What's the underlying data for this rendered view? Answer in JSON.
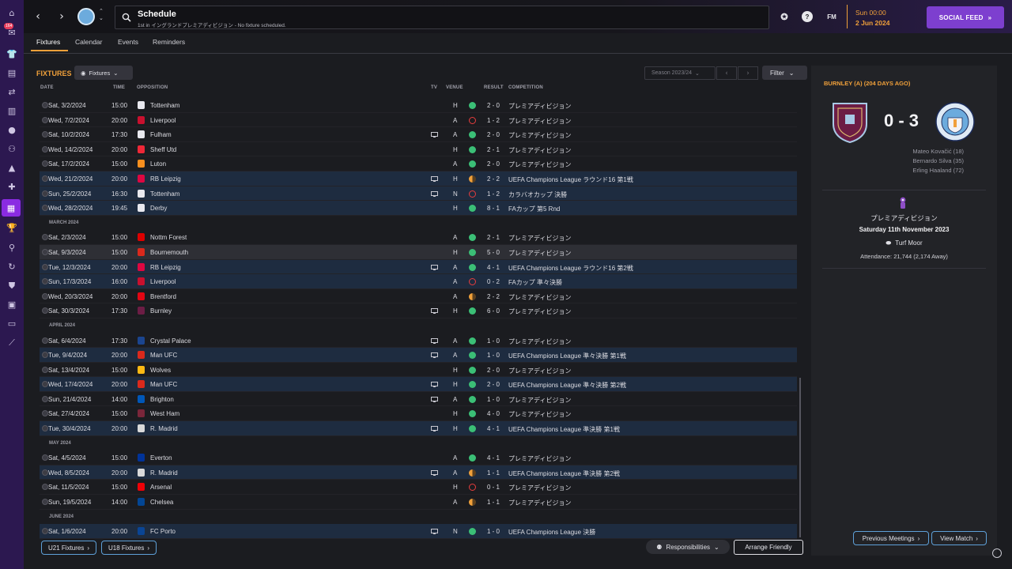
{
  "sidebar": {
    "badge": "164"
  },
  "topbar": {
    "title": "Schedule",
    "subtitle": "1st in イングランドプレミアディビジョン - No fixture scheduled.",
    "help_label": "?",
    "fm_label": "FM",
    "time": "Sun 00:00",
    "date": "2 Jun 2024",
    "social_feed": "SOCIAL FEED"
  },
  "tabs": [
    "Fixtures",
    "Calendar",
    "Events",
    "Reminders"
  ],
  "toolbar": {
    "title": "FIXTURES",
    "view_dropdown": "Fixtures",
    "season": "Season 2023/24",
    "filter": "Filter"
  },
  "columns": {
    "date": "DATE",
    "time": "TIME",
    "opposition": "OPPOSITION",
    "tv": "TV",
    "venue": "VENUE",
    "result": "RESULT",
    "competition": "COMPETITION"
  },
  "fixtures": [
    {
      "date": "Sat, 3/2/2024",
      "time": "15:00",
      "opp": "Tottenham",
      "tv": false,
      "venue": "H",
      "res": "W",
      "score": "2 - 0",
      "comp": "プレミアディビジョン",
      "hl": false
    },
    {
      "date": "Wed, 7/2/2024",
      "time": "20:00",
      "opp": "Liverpool",
      "tv": false,
      "venue": "A",
      "res": "L",
      "score": "1 - 2",
      "comp": "プレミアディビジョン",
      "hl": false
    },
    {
      "date": "Sat, 10/2/2024",
      "time": "17:30",
      "opp": "Fulham",
      "tv": true,
      "venue": "A",
      "res": "W",
      "score": "2 - 0",
      "comp": "プレミアディビジョン",
      "hl": false
    },
    {
      "date": "Wed, 14/2/2024",
      "time": "20:00",
      "opp": "Sheff Utd",
      "tv": false,
      "venue": "H",
      "res": "W",
      "score": "2 - 1",
      "comp": "プレミアディビジョン",
      "hl": false
    },
    {
      "date": "Sat, 17/2/2024",
      "time": "15:00",
      "opp": "Luton",
      "tv": false,
      "venue": "A",
      "res": "W",
      "score": "2 - 0",
      "comp": "プレミアディビジョン",
      "hl": false
    },
    {
      "date": "Wed, 21/2/2024",
      "time": "20:00",
      "opp": "RB Leipzig",
      "tv": true,
      "venue": "H",
      "res": "D",
      "score": "2 - 2",
      "comp": "UEFA Champions League ラウンド16 第1戦",
      "hl": true
    },
    {
      "date": "Sun, 25/2/2024",
      "time": "16:30",
      "opp": "Tottenham",
      "tv": true,
      "venue": "N",
      "res": "L",
      "score": "1 - 2",
      "comp": "カラバオカップ 決勝",
      "hl": true
    },
    {
      "date": "Wed, 28/2/2024",
      "time": "19:45",
      "opp": "Derby",
      "tv": false,
      "venue": "H",
      "res": "W",
      "score": "8 - 1",
      "comp": "FAカップ 第5 Rnd",
      "hl": true
    },
    {
      "month": "MARCH 2024"
    },
    {
      "date": "Sat, 2/3/2024",
      "time": "15:00",
      "opp": "Nottm Forest",
      "tv": false,
      "venue": "A",
      "res": "W",
      "score": "2 - 1",
      "comp": "プレミアディビジョン",
      "hl": false
    },
    {
      "date": "Sat, 9/3/2024",
      "time": "15:00",
      "opp": "Bournemouth",
      "tv": false,
      "venue": "H",
      "res": "W",
      "score": "5 - 0",
      "comp": "プレミアディビジョン",
      "hl": false,
      "sel": true
    },
    {
      "date": "Tue, 12/3/2024",
      "time": "20:00",
      "opp": "RB Leipzig",
      "tv": true,
      "venue": "A",
      "res": "W",
      "score": "4 - 1",
      "comp": "UEFA Champions League ラウンド16 第2戦",
      "hl": true
    },
    {
      "date": "Sun, 17/3/2024",
      "time": "16:00",
      "opp": "Liverpool",
      "tv": false,
      "venue": "A",
      "res": "L",
      "score": "0 - 2",
      "comp": "FAカップ 準々決勝",
      "hl": true
    },
    {
      "date": "Wed, 20/3/2024",
      "time": "20:00",
      "opp": "Brentford",
      "tv": false,
      "venue": "A",
      "res": "D",
      "score": "2 - 2",
      "comp": "プレミアディビジョン",
      "hl": false
    },
    {
      "date": "Sat, 30/3/2024",
      "time": "17:30",
      "opp": "Burnley",
      "tv": true,
      "venue": "H",
      "res": "W",
      "score": "6 - 0",
      "comp": "プレミアディビジョン",
      "hl": false
    },
    {
      "month": "APRIL 2024"
    },
    {
      "date": "Sat, 6/4/2024",
      "time": "17:30",
      "opp": "Crystal Palace",
      "tv": true,
      "venue": "A",
      "res": "W",
      "score": "1 - 0",
      "comp": "プレミアディビジョン",
      "hl": false
    },
    {
      "date": "Tue, 9/4/2024",
      "time": "20:00",
      "opp": "Man UFC",
      "tv": true,
      "venue": "A",
      "res": "W",
      "score": "1 - 0",
      "comp": "UEFA Champions League 準々決勝 第1戦",
      "hl": true
    },
    {
      "date": "Sat, 13/4/2024",
      "time": "15:00",
      "opp": "Wolves",
      "tv": false,
      "venue": "H",
      "res": "W",
      "score": "2 - 0",
      "comp": "プレミアディビジョン",
      "hl": false
    },
    {
      "date": "Wed, 17/4/2024",
      "time": "20:00",
      "opp": "Man UFC",
      "tv": true,
      "venue": "H",
      "res": "W",
      "score": "2 - 0",
      "comp": "UEFA Champions League 準々決勝 第2戦",
      "hl": true
    },
    {
      "date": "Sun, 21/4/2024",
      "time": "14:00",
      "opp": "Brighton",
      "tv": true,
      "venue": "A",
      "res": "W",
      "score": "1 - 0",
      "comp": "プレミアディビジョン",
      "hl": false
    },
    {
      "date": "Sat, 27/4/2024",
      "time": "15:00",
      "opp": "West Ham",
      "tv": false,
      "venue": "H",
      "res": "W",
      "score": "4 - 0",
      "comp": "プレミアディビジョン",
      "hl": false
    },
    {
      "date": "Tue, 30/4/2024",
      "time": "20:00",
      "opp": "R. Madrid",
      "tv": true,
      "venue": "H",
      "res": "W",
      "score": "4 - 1",
      "comp": "UEFA Champions League 準決勝 第1戦",
      "hl": true
    },
    {
      "month": "MAY 2024"
    },
    {
      "date": "Sat, 4/5/2024",
      "time": "15:00",
      "opp": "Everton",
      "tv": false,
      "venue": "A",
      "res": "W",
      "score": "4 - 1",
      "comp": "プレミアディビジョン",
      "hl": false
    },
    {
      "date": "Wed, 8/5/2024",
      "time": "20:00",
      "opp": "R. Madrid",
      "tv": true,
      "venue": "A",
      "res": "D",
      "score": "1 - 1",
      "comp": "UEFA Champions League 準決勝 第2戦",
      "hl": true
    },
    {
      "date": "Sat, 11/5/2024",
      "time": "15:00",
      "opp": "Arsenal",
      "tv": false,
      "venue": "H",
      "res": "L",
      "score": "0 - 1",
      "comp": "プレミアディビジョン",
      "hl": false
    },
    {
      "date": "Sun, 19/5/2024",
      "time": "14:00",
      "opp": "Chelsea",
      "tv": false,
      "venue": "A",
      "res": "D",
      "score": "1 - 1",
      "comp": "プレミアディビジョン",
      "hl": false
    },
    {
      "month": "JUNE 2024"
    },
    {
      "date": "Sat, 1/6/2024",
      "time": "20:00",
      "opp": "FC Porto",
      "tv": true,
      "venue": "N",
      "res": "W",
      "score": "1 - 0",
      "comp": "UEFA Champions League 決勝",
      "hl": true
    }
  ],
  "bottom": {
    "u21": "U21 Fixtures",
    "u18": "U18 Fixtures",
    "responsibilities": "Responsibilities",
    "arrange": "Arrange Friendly"
  },
  "panel": {
    "header": "BURNLEY (A) (204 DAYS AGO)",
    "score": "0 - 3",
    "scorers": [
      "Mateo Kovačić (18)",
      "Bernardo Silva (35)",
      "Erling Haaland (72)"
    ],
    "competition": "プレミアディビジョン",
    "date": "Saturday 11th November 2023",
    "stadium": "Turf Moor",
    "attendance": "Attendance: 21,744 (2,174 Away)",
    "prev_meetings": "Previous Meetings",
    "view_match": "View Match"
  },
  "colors": {
    "accent": "#f0a03a",
    "win": "#3bbf76",
    "loss": "#e83d3d",
    "highlight_row": "#1e2c40",
    "purple": "#7d3fcf"
  }
}
